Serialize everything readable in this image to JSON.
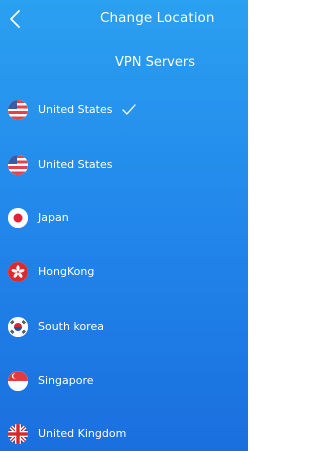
{
  "header": {
    "title": "Change Location",
    "back_icon": "chevron-left-icon"
  },
  "section": {
    "title": "VPN Servers"
  },
  "servers": [
    {
      "name": "United States",
      "flag": "us",
      "selected": true
    },
    {
      "name": "United States",
      "flag": "us",
      "selected": false
    },
    {
      "name": "Japan",
      "flag": "jp",
      "selected": false
    },
    {
      "name": "HongKong",
      "flag": "hk",
      "selected": false
    },
    {
      "name": "South korea",
      "flag": "kr",
      "selected": false
    },
    {
      "name": "Singapore",
      "flag": "sg",
      "selected": false
    },
    {
      "name": "United Kingdom",
      "flag": "gb",
      "selected": false
    }
  ],
  "colors": {
    "background_top": "#2aa0f0",
    "background_bottom": "#1a6fde",
    "text": "#ffffff"
  }
}
